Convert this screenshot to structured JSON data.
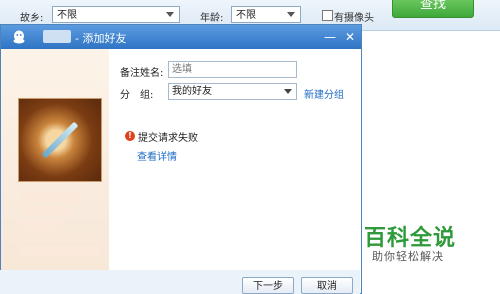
{
  "background_app": {
    "hometown_label": "故乡:",
    "hometown_value": "不限",
    "age_label": "年龄:",
    "age_value": "不限",
    "has_photo_label": "有摄像头",
    "find_button": "查找"
  },
  "dialog": {
    "title": "- 添加好友",
    "remark_label": "备注姓名:",
    "remark_placeholder": "选填",
    "group_label": "分　组:",
    "group_value": "我的好友",
    "new_group_link": "新建分组",
    "error_message": "提交请求失败",
    "details_link": "查看详情",
    "next_button": "下一步",
    "cancel_button": "取消",
    "minimize_glyph": "—",
    "close_glyph": "✕",
    "error_glyph": "!"
  },
  "watermark": {
    "brand": "百科全说",
    "slogan": "助你轻松解决"
  },
  "colors": {
    "titlebar": "#2f74c4",
    "link": "#1d6ac4",
    "error": "#e0421d",
    "find_button": "#3fa83a",
    "watermark": "#2e9a3a"
  }
}
